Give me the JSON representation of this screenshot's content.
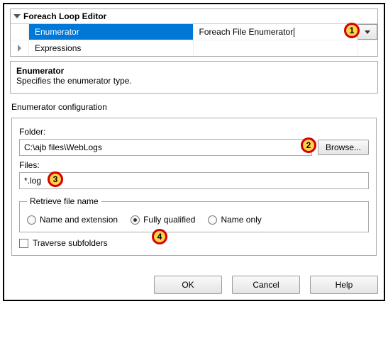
{
  "header": {
    "title": "Foreach Loop Editor"
  },
  "grid": {
    "row1": {
      "name": "Enumerator",
      "value": "Foreach File Enumerator"
    },
    "row2": {
      "name": "Expressions",
      "value": ""
    }
  },
  "description": {
    "title": "Enumerator",
    "text": "Specifies the enumerator type."
  },
  "config": {
    "title": "Enumerator configuration",
    "folder": {
      "label": "Folder:",
      "value": "C:\\ajb files\\WebLogs",
      "browse": "Browse..."
    },
    "files": {
      "label": "Files:",
      "value": "*.log"
    },
    "retrieve": {
      "legend": "Retrieve file name",
      "opt1": "Name and extension",
      "opt2": "Fully qualified",
      "opt3": "Name only",
      "selected": "opt2"
    },
    "traverse": "Traverse subfolders"
  },
  "buttons": {
    "ok": "OK",
    "cancel": "Cancel",
    "help": "Help"
  },
  "markers": {
    "m1": "1",
    "m2": "2",
    "m3": "3",
    "m4": "4"
  }
}
